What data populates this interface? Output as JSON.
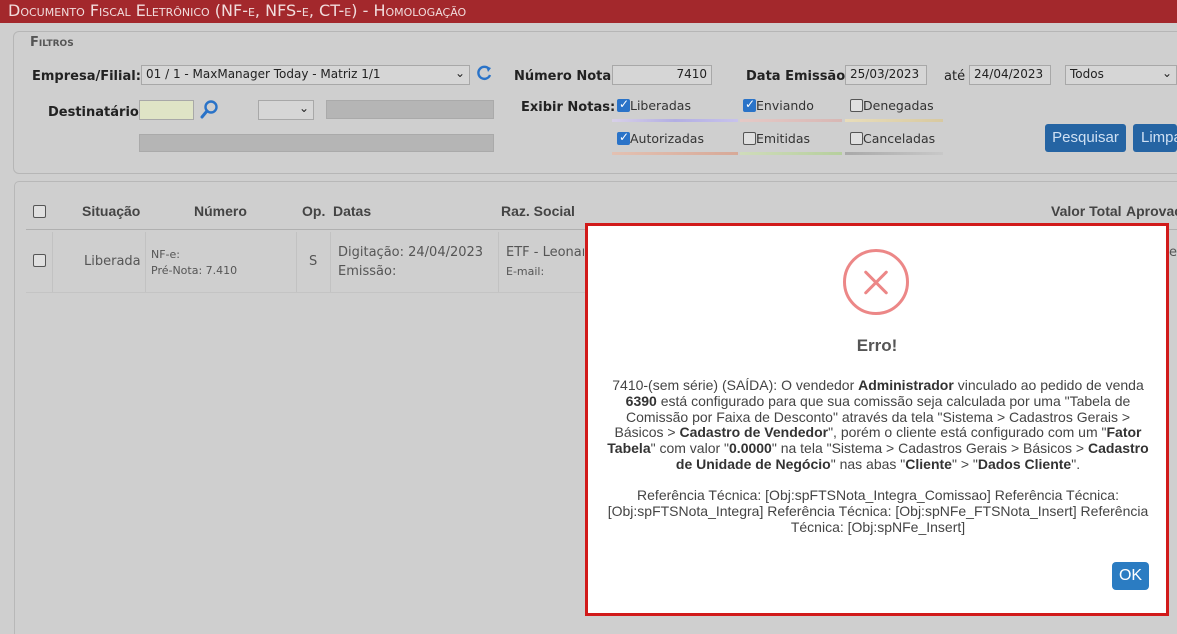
{
  "window": {
    "title": "Documento Fiscal Eletrônico (NF-e, NFS-e, CT-e)  - Homologação"
  },
  "filters": {
    "legend": "Filtros",
    "empresa_label": "Empresa/Filial:",
    "empresa_value": "01 / 1 - MaxManager Today - Matriz 1/1",
    "numero_label": "Número Nota:",
    "numero_value": "7410",
    "data_emissao_label": "Data Emissão:",
    "data_inicio": "25/03/2023",
    "ate_label": "até",
    "data_fim": "24/04/2023",
    "status_select": "Todos",
    "destinatario_label": "Destinatário:",
    "destinatario_value": "",
    "exibir_label": "Exibir Notas:",
    "checkboxes": [
      {
        "label": "Liberadas",
        "checked": true,
        "color": "#b5b0d8"
      },
      {
        "label": "Enviando",
        "checked": true,
        "color": "#c9b8b1"
      },
      {
        "label": "Denegadas",
        "checked": false,
        "color": "#d5c9a7"
      },
      {
        "label": "Autorizadas",
        "checked": true,
        "color": "#c9b1a3"
      },
      {
        "label": "Emitidas",
        "checked": false,
        "color": "#b8c9a4"
      },
      {
        "label": "Canceladas",
        "checked": false,
        "color": "#c4c4c4"
      }
    ],
    "pesquisar_label": "Pesquisar",
    "limpar_label": "Limpar"
  },
  "grid": {
    "columns": [
      "Situação",
      "Número",
      "Op.",
      "Datas",
      "Raz. Social",
      "Valor Total",
      "Aprovação"
    ],
    "rows": [
      {
        "situacao": "Liberada",
        "numero_line1": "NF-e:",
        "numero_line2": "Pré-Nota: 7.410",
        "op": "S",
        "datas_line1": "Digitação: 24/04/2023",
        "datas_line2": "Emissão:",
        "razao_line1": "ETF - Leonardo",
        "razao_line2": "E-mail:",
        "aprovacao": "e"
      }
    ]
  },
  "dialog": {
    "title": "Erro!",
    "msg_p1": "7410-(sem série) (SAÍDA): O vendedor ",
    "msg_b1": "Administrador",
    "msg_p2": " vinculado ao pedido de venda ",
    "msg_b2": "6390",
    "msg_p3": " está configurado para que sua comissão seja calculada por uma \"Tabela de Comissão por Faixa de Desconto\" através da tela \"Sistema > Cadastros Gerais > Básicos > ",
    "msg_b3": "Cadastro de Vendedor",
    "msg_p4": "\", porém o cliente está configurado com um \"",
    "msg_b4": "Fator Tabela",
    "msg_p5": "\" com valor \"",
    "msg_b5": "0.0000",
    "msg_p6": "\" na tela \"Sistema > Cadastros Gerais > Básicos > ",
    "msg_b6": "Cadastro de Unidade de Negócio",
    "msg_p7": "\" nas abas \"",
    "msg_b7": "Cliente",
    "msg_p8": "\" > \"",
    "msg_b8": "Dados Cliente",
    "msg_p9": "\".",
    "reference": "Referência Técnica: [Obj:spFTSNota_Integra_Comissao] Referência Técnica: [Obj:spFTSNota_Integra] Referência Técnica: [Obj:spNFe_FTSNota_Insert] Referência Técnica: [Obj:spNFe_Insert]",
    "ok_label": "OK",
    "icon": "error-x-icon"
  }
}
